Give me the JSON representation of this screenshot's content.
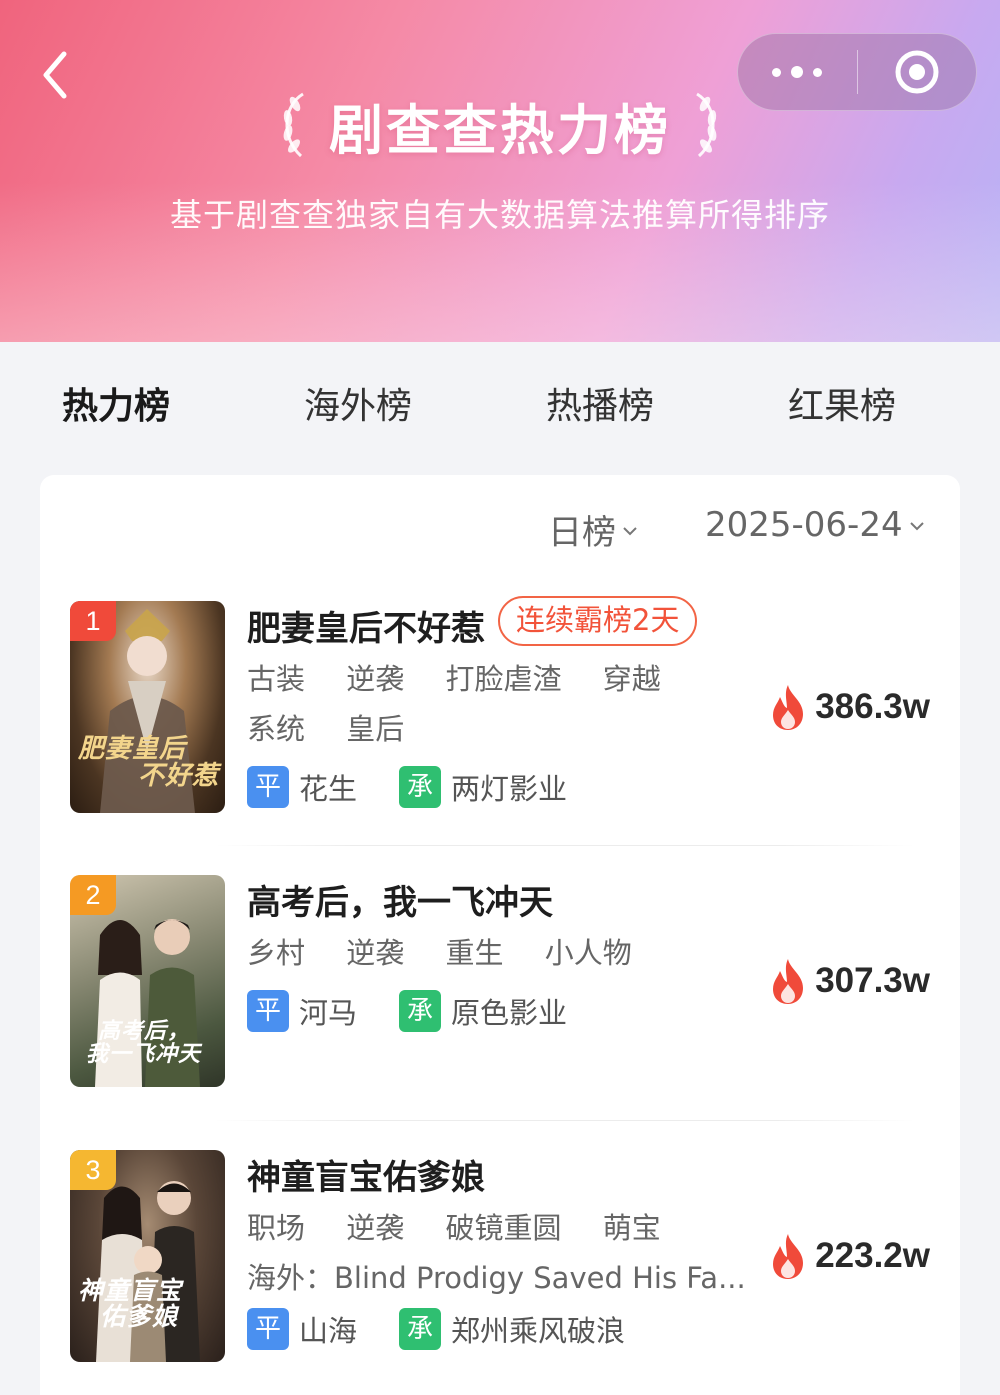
{
  "header": {
    "title": "剧查查热力榜",
    "subtitle": "基于剧查查独家自有大数据算法推算所得排序",
    "gradient_colors": [
      "#f0647d",
      "#efa0d6",
      "#b7b4f6"
    ]
  },
  "tabs": [
    {
      "label": "热力榜",
      "active": true
    },
    {
      "label": "海外榜",
      "active": false
    },
    {
      "label": "热播榜",
      "active": false
    },
    {
      "label": "红果榜",
      "active": false
    }
  ],
  "filters": {
    "period": "日榜",
    "date": "2025-06-24"
  },
  "colors": {
    "accent": "#f04a3a",
    "platform_tag": "#4a90f0",
    "producer_tag": "#2fbf71",
    "rank_1": "#f04a3a",
    "rank_2": "#f59a23",
    "rank_3": "#f5b731"
  },
  "ranking": [
    {
      "rank": "1",
      "title": "肥妻皇后不好惹",
      "streak": "连续霸榜2天",
      "tags_line1": [
        "古装",
        "逆袭",
        "打脸虐渣",
        "穿越"
      ],
      "tags_line2": [
        "系统",
        "皇后"
      ],
      "platform_label": "平",
      "platform": "花生",
      "producer_label": "承",
      "producer": "两灯影业",
      "heat": "386.3w",
      "poster_text_1": "肥妻皇后",
      "poster_text_2": "不好惹"
    },
    {
      "rank": "2",
      "title": "高考后，我一飞冲天",
      "tags_line1": [
        "乡村",
        "逆袭",
        "重生",
        "小人物"
      ],
      "platform_label": "平",
      "platform": "河马",
      "producer_label": "承",
      "producer": "原色影业",
      "heat": "307.3w",
      "poster_text_1": "高考后，",
      "poster_text_2": "我一飞冲天"
    },
    {
      "rank": "3",
      "title": "神童盲宝佑爹娘",
      "tags_line1": [
        "职场",
        "逆袭",
        "破镜重圆",
        "萌宝"
      ],
      "overseas": "海外：Blind Prodigy Saved His Fa...",
      "platform_label": "平",
      "platform": "山海",
      "producer_label": "承",
      "producer": "郑州乘风破浪",
      "heat": "223.2w",
      "poster_text_1": "神童盲宝",
      "poster_text_2": "佑爹娘"
    }
  ]
}
